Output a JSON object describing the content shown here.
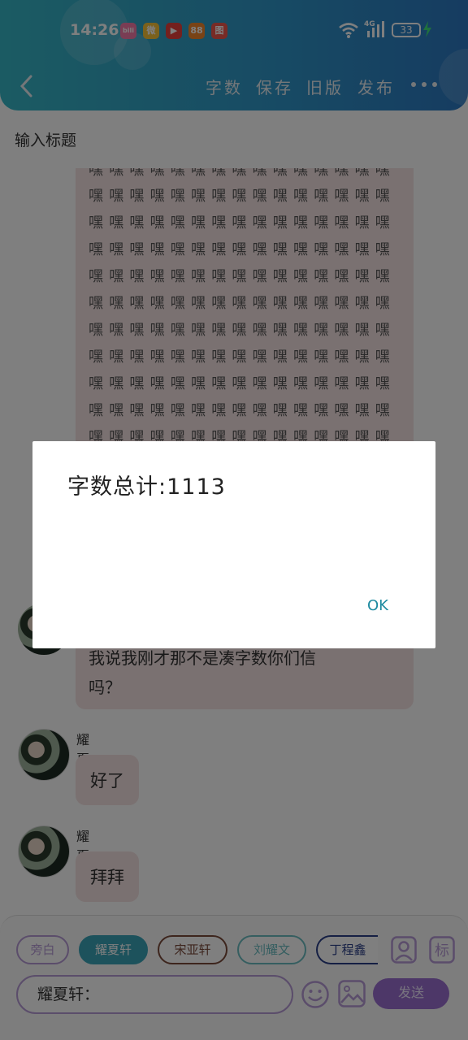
{
  "status_bar": {
    "time": "14:26",
    "network": "4G",
    "battery": "33",
    "apps": [
      {
        "icon": "bilibili-icon",
        "glyph": "bili",
        "color": "#f57aa8"
      },
      {
        "icon": "weibo-icon",
        "glyph": "微",
        "color": "#f6c338"
      },
      {
        "icon": "video-app-icon",
        "glyph": "▶",
        "color": "#e9413c"
      },
      {
        "icon": "orange-app-icon",
        "glyph": "88",
        "color": "#f3862c"
      },
      {
        "icon": "photo-app-icon",
        "glyph": "图",
        "color": "#f0564d"
      }
    ]
  },
  "header": {
    "menu": [
      "字数",
      "保存",
      "旧版",
      "发布"
    ]
  },
  "editor": {
    "title_placeholder": "输入标题",
    "hei_line": "嘿嘿嘿嘿嘿嘿嘿嘿嘿嘿嘿嘿嘿嘿嘿"
  },
  "messages": [
    {
      "name": "",
      "text": "我说我刚才那不是凑字数你们信\n吗？"
    },
    {
      "name": "耀夏轩",
      "text": "好了"
    },
    {
      "name": "耀夏轩",
      "text": "拜拜"
    }
  ],
  "composer": {
    "chips": [
      "旁白",
      "耀夏轩",
      "宋亚轩",
      "刘耀文",
      "丁程鑫"
    ],
    "input_value": "耀夏轩：",
    "send_label": "发送"
  },
  "dialog": {
    "message": "字数总计:1113",
    "ok_label": "OK"
  },
  "colors": {
    "header_start": "#37b7c6",
    "header_end": "#2c78c2",
    "bubble_bg": "#f4e3e3",
    "accent_teal": "#1d8aa0",
    "accent_purple": "#9b6fd0"
  }
}
